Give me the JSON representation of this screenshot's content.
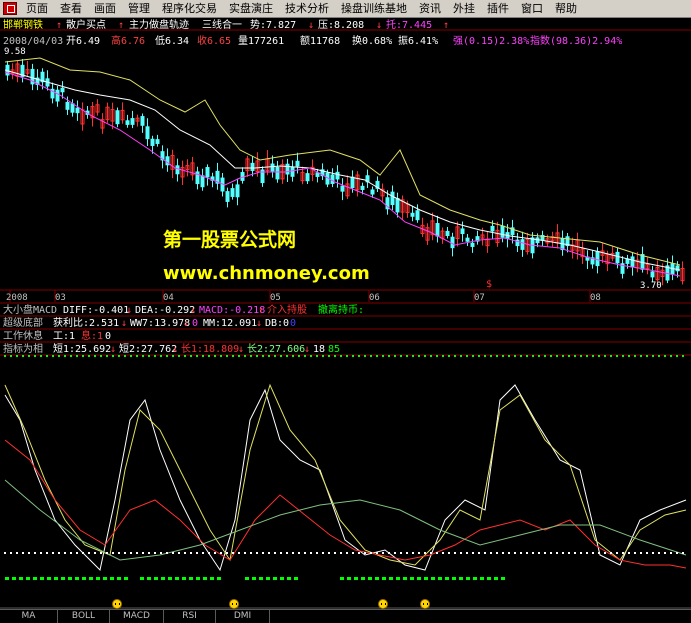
{
  "menubar": {
    "items": [
      "页面",
      "查看",
      "画面",
      "管理",
      "程序化交易",
      "实盘演庄",
      "技术分析",
      "操盘训练基地",
      "资讯",
      "外挂",
      "插件",
      "窗口",
      "帮助"
    ]
  },
  "header": {
    "stock_name": "邯郸钢铁",
    "indicator_1": "散户买点",
    "indicator_2": "主力做盘轨迹",
    "indicator_3": "三线合一",
    "trend_text": "势:7.827",
    "pressure_text": "压:8.208",
    "support_text": "托:7.445"
  },
  "quote": {
    "date": "2008/04/03",
    "open": "开6.49",
    "high": "高6.76",
    "low": "低6.34",
    "close": "收6.65",
    "volume": "量177261",
    "amount": "额11768",
    "turnover": "换0.68%",
    "amplitude": "振6.41%",
    "strength": "强(0.15)2.38%",
    "index": "指数(98.36)2.94%"
  },
  "price_chart": {
    "high_label": "9.58",
    "low_label": "3.70",
    "marker": "$",
    "watermark_1": "第一股票公式网",
    "watermark_2": "www.chnmoney.com",
    "x_labels": [
      "2008",
      "03",
      "04",
      "05",
      "06",
      "07",
      "08"
    ]
  },
  "panels": {
    "macd": {
      "name": "大小盘MACD",
      "diff": "DIFF:-0.401",
      "dea": "DEA:-0.292",
      "macd": "MACD:-0.218",
      "buy": "介入持股",
      "sell": "撤离持币:"
    },
    "bottom": {
      "name": "超级底部",
      "profit": "获利比:2.531",
      "ww": "WW7:13.978",
      "v0": "0",
      "mm": "MM:12.091",
      "db": "DB:0",
      "v1": "0"
    },
    "rest": {
      "name": "工作休息",
      "work": "工:1",
      "rest": "息:1",
      "v": "0"
    },
    "kdj": {
      "name": "指标为相",
      "short1": "短1:25.692",
      "short2": "短2:27.762",
      "long1": "长1:18.809",
      "long2": "长2:27.606",
      "v18": "18",
      "v85": "85"
    }
  },
  "tabs": [
    "MA",
    "BOLL",
    "MACD",
    "RSI",
    "DMI"
  ],
  "colors": {
    "up": "#ff3030",
    "down": "#54ffff",
    "ma_white": "#ffffff",
    "ma_yellow": "#e0e060",
    "ma_magenta": "#ff40ff",
    "watermark": "#ffff00",
    "green_dots": "#00ff00"
  }
}
